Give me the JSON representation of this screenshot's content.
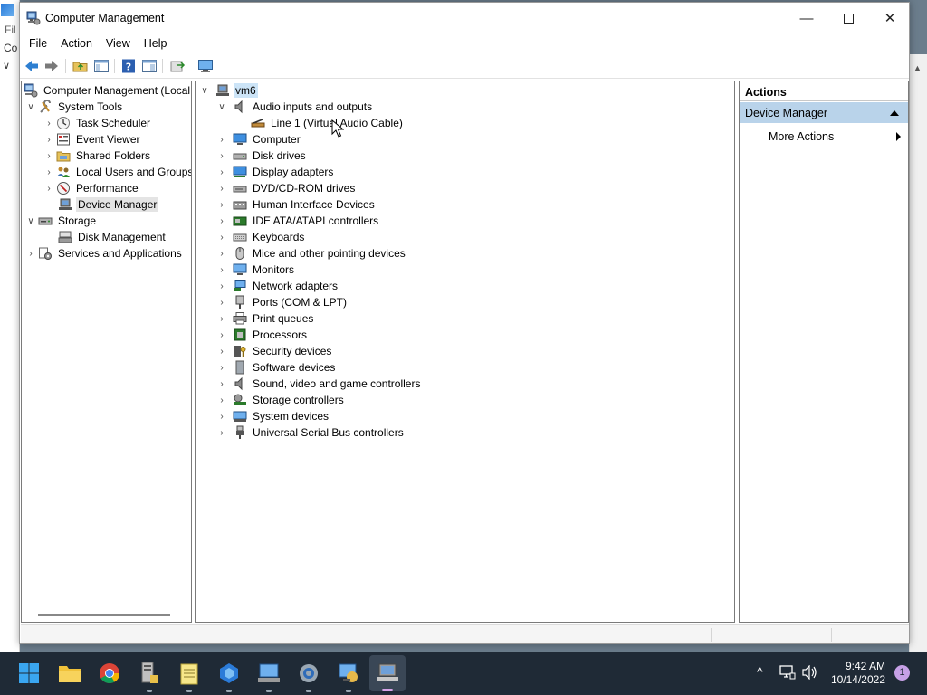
{
  "background": {
    "partial_menu_text": "Fil",
    "partial_tab_text": "Co"
  },
  "window": {
    "title": "Computer Management",
    "controls": {
      "minimize": "—",
      "close": "✕"
    }
  },
  "menubar": [
    "File",
    "Action",
    "View",
    "Help"
  ],
  "toolbar": [
    "back-icon",
    "forward-icon",
    "up-folder-icon",
    "show-hide-tree-icon",
    "help-icon",
    "action-pane-icon",
    "export-icon",
    "monitor-icon"
  ],
  "left_tree": {
    "items": [
      {
        "label": "Computer Management (Local",
        "icon": "computer-management-icon",
        "expander": ""
      },
      {
        "label": "System Tools",
        "icon": "system-tools-icon",
        "expander": "v"
      },
      {
        "label": "Task Scheduler",
        "icon": "clock-icon",
        "expander": ">"
      },
      {
        "label": "Event Viewer",
        "icon": "event-viewer-icon",
        "expander": ">"
      },
      {
        "label": "Shared Folders",
        "icon": "shared-folder-icon",
        "expander": ">"
      },
      {
        "label": "Local Users and Groups",
        "icon": "users-icon",
        "expander": ">"
      },
      {
        "label": "Performance",
        "icon": "performance-icon",
        "expander": ">"
      },
      {
        "label": "Device Manager",
        "icon": "device-manager-icon",
        "expander": ""
      },
      {
        "label": "Storage",
        "icon": "storage-icon",
        "expander": "v"
      },
      {
        "label": "Disk Management",
        "icon": "disk-management-icon",
        "expander": ""
      },
      {
        "label": "Services and Applications",
        "icon": "services-icon",
        "expander": ">"
      }
    ]
  },
  "device_tree": {
    "root": "vm6",
    "categories": [
      {
        "label": "Audio inputs and outputs",
        "expander": "v"
      },
      {
        "label": "Line 1 (Virtual Audio Cable)",
        "expander": ""
      },
      {
        "label": "Computer",
        "expander": ">"
      },
      {
        "label": "Disk drives",
        "expander": ">"
      },
      {
        "label": "Display adapters",
        "expander": ">"
      },
      {
        "label": "DVD/CD-ROM drives",
        "expander": ">"
      },
      {
        "label": "Human Interface Devices",
        "expander": ">"
      },
      {
        "label": "IDE ATA/ATAPI controllers",
        "expander": ">"
      },
      {
        "label": "Keyboards",
        "expander": ">"
      },
      {
        "label": "Mice and other pointing devices",
        "expander": ">"
      },
      {
        "label": "Monitors",
        "expander": ">"
      },
      {
        "label": "Network adapters",
        "expander": ">"
      },
      {
        "label": "Ports (COM & LPT)",
        "expander": ">"
      },
      {
        "label": "Print queues",
        "expander": ">"
      },
      {
        "label": "Processors",
        "expander": ">"
      },
      {
        "label": "Security devices",
        "expander": ">"
      },
      {
        "label": "Software devices",
        "expander": ">"
      },
      {
        "label": "Sound, video and game controllers",
        "expander": ">"
      },
      {
        "label": "Storage controllers",
        "expander": ">"
      },
      {
        "label": "System devices",
        "expander": ">"
      },
      {
        "label": "Universal Serial Bus controllers",
        "expander": ">"
      }
    ]
  },
  "actions": {
    "header": "Actions",
    "section": "Device Manager",
    "more": "More Actions"
  },
  "taskbar": {
    "apps": [
      "start-icon",
      "file-explorer-icon",
      "chrome-icon",
      "file-server-icon",
      "notepad-icon",
      "hyperv-icon",
      "computer-management-taskbar-icon",
      "settings-icon",
      "remote-desktop-icon",
      "device-manager-taskbar-icon"
    ],
    "tray_chevron": "^",
    "time": "9:42 AM",
    "date": "10/14/2022",
    "notification_count": "1"
  },
  "colors": {
    "accent_selection": "#cce4f7",
    "actions_section": "#b9d3ea",
    "taskbar": "#1f2a36"
  }
}
